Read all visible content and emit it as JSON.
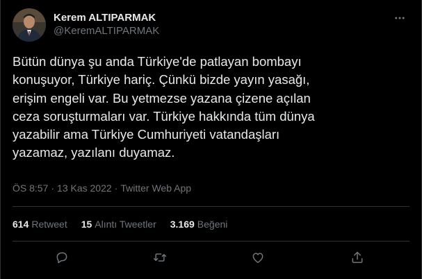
{
  "user": {
    "display_name": "Kerem ALTIPARMAK",
    "handle": "@KeremALTIPARMAK"
  },
  "tweet": {
    "text": "Bütün dünya şu anda Türkiye'de patlayan bombayı\nkonuşuyor, Türkiye hariç. Çünkü bizde yayın yasağı,\nerişim engeli var. Bu yetmezse yazana çizene açılan\nceza soruşturmaları var. Türkiye hakkında tüm dünya\nyazabilir ama Türkiye Cumhuriyeti vatandaşları\nyazamaz, yazılanı duyamaz.",
    "time": "ÖS 8:57",
    "date": "13 Kas 2022",
    "source": "Twitter Web App",
    "separator": "·"
  },
  "stats": {
    "retweets_count": "614",
    "retweets_label": "Retweet",
    "quotes_count": "15",
    "quotes_label": "Alıntı Tweetler",
    "likes_count": "3.169",
    "likes_label": "Beğeni"
  },
  "icons": {
    "more": "more-icon",
    "reply": "reply-icon",
    "retweet": "retweet-icon",
    "like": "like-icon",
    "share": "share-icon"
  },
  "colors": {
    "background": "#000000",
    "primary_text": "#e7e9ea",
    "secondary_text": "#71767b",
    "divider": "#2f3336"
  }
}
